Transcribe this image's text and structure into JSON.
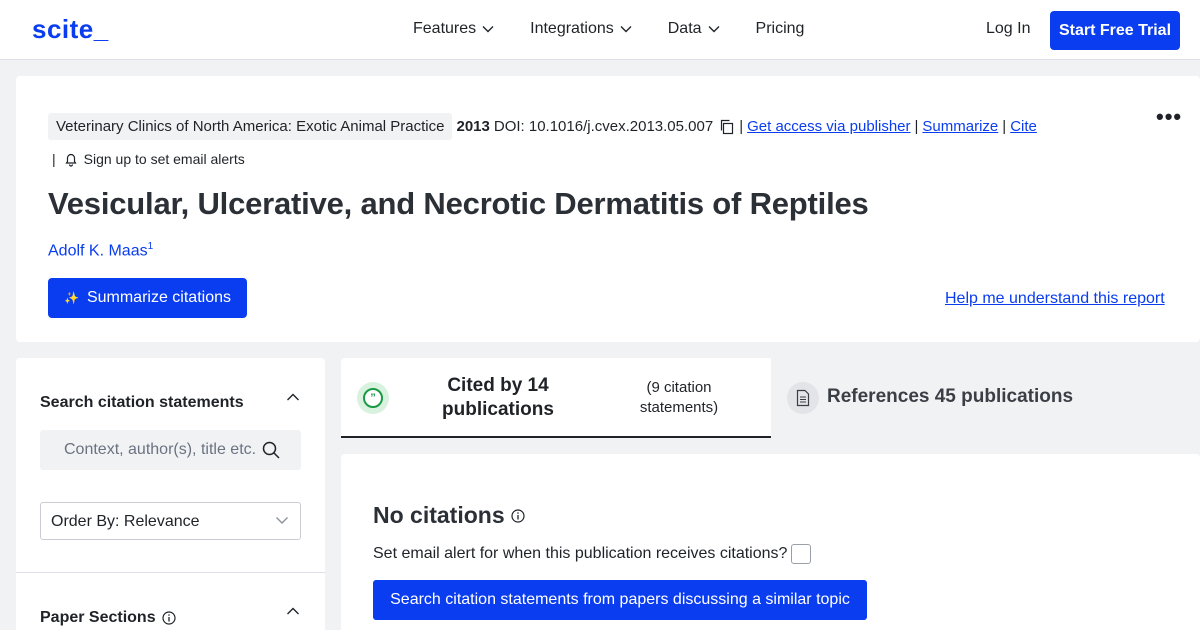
{
  "header": {
    "logo": "scite_",
    "nav": [
      {
        "label": "Features",
        "has_dropdown": true
      },
      {
        "label": "Integrations",
        "has_dropdown": true
      },
      {
        "label": "Data",
        "has_dropdown": true
      },
      {
        "label": "Pricing",
        "has_dropdown": false
      }
    ],
    "login_label": "Log In",
    "trial_label": "Start Free Trial"
  },
  "paper": {
    "journal": "Veterinary Clinics of North America: Exotic Animal Practice",
    "year": "2013",
    "doi": "DOI: 10.1016/j.cvex.2013.05.007",
    "links": {
      "access": "Get access via publisher",
      "summarize": "Summarize",
      "cite": "Cite"
    },
    "separator": "|",
    "alert_label": "Sign up to set email alerts",
    "title": "Vesicular, Ulcerative, and Necrotic Dermatitis of Reptiles",
    "author": "Adolf K. Maas",
    "author_sup": "1",
    "summarize_button": "Summarize citations",
    "help_link": "Help me understand this report",
    "more_label": "•••"
  },
  "sidebar": {
    "search_heading": "Search citation statements",
    "search_placeholder": "Context, author(s), title etc.",
    "order_by": "Order By: Relevance",
    "sections_heading": "Paper Sections"
  },
  "tabs": {
    "cited_label": "Cited by 14 publications",
    "cited_sub": "(9 citation statements)",
    "refs_label": "References 45 publications"
  },
  "main": {
    "no_citations": "No citations",
    "alert_question": "Set email alert for when this publication receives citations?",
    "search_button": "Search citation statements from papers discussing a similar topic"
  },
  "colors": {
    "accent": "#0a3cf0",
    "background": "#f1f2f4",
    "quote_green": "#1b9a45"
  }
}
